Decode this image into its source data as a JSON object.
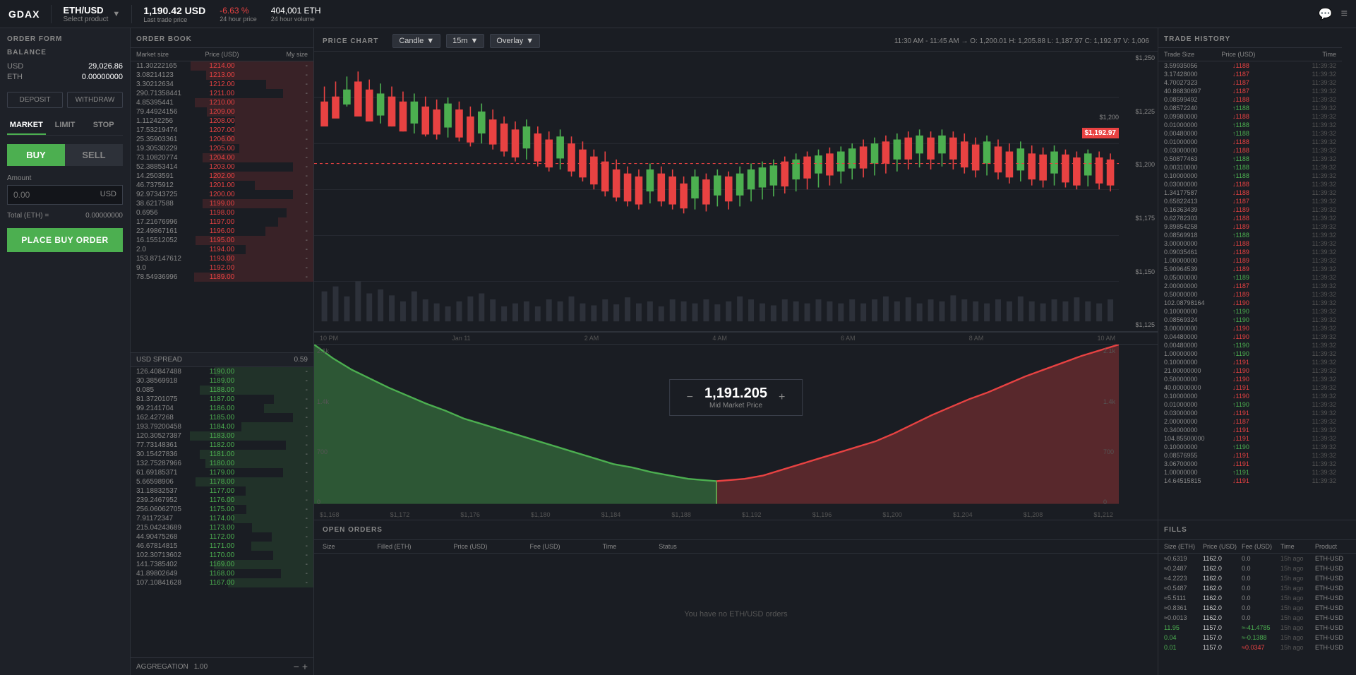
{
  "nav": {
    "logo": "GDAX",
    "pair": "ETH/USD",
    "pair_sub": "Select product",
    "last_price": "1,190.42 USD",
    "last_label": "Last trade price",
    "change": "-6.63 %",
    "change_label": "24 hour price",
    "volume": "404,001 ETH",
    "volume_label": "24 hour volume",
    "chat_icon": "💬",
    "menu_icon": "≡"
  },
  "order_form": {
    "title": "ORDER FORM",
    "balance_title": "BALANCE",
    "usd_label": "USD",
    "usd_amount": "29,026.86",
    "eth_label": "ETH",
    "eth_amount": "0.00000000",
    "deposit_label": "DEPOSIT",
    "withdraw_label": "WITHDRAW",
    "tab_market": "MARKET",
    "tab_limit": "LIMIT",
    "tab_stop": "STOP",
    "buy_label": "BUY",
    "sell_label": "SELL",
    "amount_label": "Amount",
    "amount_placeholder": "0.00",
    "amount_suffix": "USD",
    "total_label": "Total (ETH) =",
    "total_value": "0.00000000",
    "place_order_btn": "PLACE BUY ORDER"
  },
  "order_book": {
    "title": "ORDER BOOK",
    "col_market_size": "Market size",
    "col_price": "Price (USD)",
    "col_my_size": "My size",
    "asks": [
      {
        "size": "11.30222165",
        "price": "1214.00"
      },
      {
        "size": "3.08214123",
        "price": "1213.00"
      },
      {
        "size": "3.30212634",
        "price": "1212.00"
      },
      {
        "size": "290.71358441",
        "price": "1211.00"
      },
      {
        "size": "4.85395441",
        "price": "1210.00"
      },
      {
        "size": "79.44924156",
        "price": "1209.00"
      },
      {
        "size": "1.11242256",
        "price": "1208.00"
      },
      {
        "size": "17.53219474",
        "price": "1207.00"
      },
      {
        "size": "25.35903361",
        "price": "1206.00"
      },
      {
        "size": "19.30530229",
        "price": "1205.00"
      },
      {
        "size": "73.10820774",
        "price": "1204.00"
      },
      {
        "size": "52.38853414",
        "price": "1203.00"
      },
      {
        "size": "14.2503591",
        "price": "1202.00"
      },
      {
        "size": "46.7375912",
        "price": "1201.00"
      },
      {
        "size": "92.97343725",
        "price": "1200.00"
      },
      {
        "size": "38.6217588",
        "price": "1199.00"
      },
      {
        "size": "0.6956",
        "price": "1198.00"
      },
      {
        "size": "17.21676996",
        "price": "1197.00"
      },
      {
        "size": "22.49867161",
        "price": "1196.00"
      },
      {
        "size": "16.15512052",
        "price": "1195.00"
      },
      {
        "size": "2.0",
        "price": "1194.00"
      },
      {
        "size": "153.87147612",
        "price": "1193.00"
      },
      {
        "size": "9.0",
        "price": "1192.00"
      },
      {
        "size": "78.54936996",
        "price": "1189.00"
      }
    ],
    "spread_label": "USD SPREAD",
    "spread_value": "0.59",
    "bids": [
      {
        "size": "126.40847488",
        "price": "1190.00"
      },
      {
        "size": "30.38569918",
        "price": "1189.00"
      },
      {
        "size": "0.085",
        "price": "1188.00"
      },
      {
        "size": "81.37201075",
        "price": "1187.00"
      },
      {
        "size": "99.2141704",
        "price": "1186.00"
      },
      {
        "size": "162.427268",
        "price": "1185.00"
      },
      {
        "size": "193.79200458",
        "price": "1184.00"
      },
      {
        "size": "120.30527387",
        "price": "1183.00"
      },
      {
        "size": "77.73148361",
        "price": "1182.00"
      },
      {
        "size": "30.15427836",
        "price": "1181.00"
      },
      {
        "size": "132.75287966",
        "price": "1180.00"
      },
      {
        "size": "61.69185371",
        "price": "1179.00"
      },
      {
        "size": "5.66598906",
        "price": "1178.00"
      },
      {
        "size": "31.18832537",
        "price": "1177.00"
      },
      {
        "size": "239.2467952",
        "price": "1176.00"
      },
      {
        "size": "256.06062705",
        "price": "1175.00"
      },
      {
        "size": "7.91172347",
        "price": "1174.00"
      },
      {
        "size": "215.04243689",
        "price": "1173.00"
      },
      {
        "size": "44.90475268",
        "price": "1172.00"
      },
      {
        "size": "46.67814815",
        "price": "1171.00"
      },
      {
        "size": "102.30713602",
        "price": "1170.00"
      },
      {
        "size": "141.7385402",
        "price": "1169.00"
      },
      {
        "size": "41.89802649",
        "price": "1168.00"
      },
      {
        "size": "107.10841628",
        "price": "1167.00"
      }
    ],
    "aggregation_label": "AGGREGATION",
    "aggregation_value": "1.00"
  },
  "price_chart": {
    "title": "PRICE CHART",
    "chart_type": "Candle",
    "timeframe": "15m",
    "overlay": "Overlay",
    "stats": "11:30 AM - 11:45 AM → O: 1,200.01  H: 1,205.88  L: 1,187.97  C: 1,192.97  V: 1,006",
    "price_levels": [
      "$1,250",
      "$1,225",
      "$1,200",
      "$1,175",
      "$1,150",
      "$1,125"
    ],
    "time_labels": [
      "10 PM",
      "Jan 11",
      "2 AM",
      "4 AM",
      "6 AM",
      "8 AM",
      "10 AM"
    ],
    "current_price_label": "$1,192.97",
    "ref_price_label": "$1,200",
    "market_price": "1,191.205",
    "market_price_label": "Mid Market Price",
    "depth_y_left": [
      "2.1k",
      "1.4k",
      "700",
      "0"
    ],
    "depth_y_right": [
      "2.1k",
      "1.4k",
      "700",
      "0"
    ],
    "depth_x_labels": [
      "$1,168",
      "$1,172",
      "$1,176",
      "$1,180",
      "$1,184",
      "$1,188",
      "$1,192",
      "$1,196",
      "$1,200",
      "$1,204",
      "$1,208",
      "$1,212"
    ]
  },
  "open_orders": {
    "title": "OPEN ORDERS",
    "col_size": "Size",
    "col_filled": "Filled (ETH)",
    "col_price": "Price (USD)",
    "col_fee": "Fee (USD)",
    "col_time": "Time",
    "col_status": "Status",
    "empty_message": "You have no ETH/USD orders"
  },
  "fills": {
    "title": "FILLS",
    "col_size": "Size (ETH)",
    "col_price": "Price (USD)",
    "col_fee": "Fee (USD)",
    "col_time": "Time",
    "col_product": "Product",
    "rows": [
      {
        "size": "≈0.6319",
        "price": "1162.0",
        "fee": "0.0",
        "time": "15h ago",
        "product": "ETH-USD",
        "side": "sell"
      },
      {
        "size": "≈0.2487",
        "price": "1162.0",
        "fee": "0.0",
        "time": "15h ago",
        "product": "ETH-USD",
        "side": "sell"
      },
      {
        "size": "≈4.2223",
        "price": "1162.0",
        "fee": "0.0",
        "time": "15h ago",
        "product": "ETH-USD",
        "side": "sell"
      },
      {
        "size": "≈0.5487",
        "price": "1162.0",
        "fee": "0.0",
        "time": "15h ago",
        "product": "ETH-USD",
        "side": "sell"
      },
      {
        "size": "≈5.5111",
        "price": "1162.0",
        "fee": "0.0",
        "time": "15h ago",
        "product": "ETH-USD",
        "side": "sell"
      },
      {
        "size": "≈0.8361",
        "price": "1162.0",
        "fee": "0.0",
        "time": "15h ago",
        "product": "ETH-USD",
        "side": "sell"
      },
      {
        "size": "≈0.0013",
        "price": "1162.0",
        "fee": "0.0",
        "time": "15h ago",
        "product": "ETH-USD",
        "side": "sell"
      },
      {
        "size": "11.95",
        "price": "1157.0",
        "fee": "≈-41.4785",
        "time": "15h ago",
        "product": "ETH-USD",
        "side": "buy"
      },
      {
        "size": "0.04",
        "price": "1157.0",
        "fee": "≈-0.1388",
        "time": "15h ago",
        "product": "ETH-USD",
        "side": "buy"
      },
      {
        "size": "0.01",
        "price": "1157.0",
        "fee": "≈0.0347",
        "time": "15h ago",
        "product": "ETH-USD",
        "side": "buy"
      }
    ]
  },
  "trade_history": {
    "title": "TRADE HISTORY",
    "col_trade_size": "Trade Size",
    "col_price": "Price (USD)",
    "col_time": "Time",
    "rows": [
      {
        "size": "3.59935056",
        "price": "1188",
        "dir": "down",
        "time": "11:39:32"
      },
      {
        "size": "3.17428000",
        "price": "1187",
        "dir": "down",
        "time": "11:39:32"
      },
      {
        "size": "4.70027323",
        "price": "1187",
        "dir": "down",
        "time": "11:39:32"
      },
      {
        "size": "40.86830697",
        "price": "1187",
        "dir": "down",
        "time": "11:39:32"
      },
      {
        "size": "0.08599492",
        "price": "1188",
        "dir": "down",
        "time": "11:39:32"
      },
      {
        "size": "0.08572240",
        "price": "1188",
        "dir": "up",
        "time": "11:39:32"
      },
      {
        "size": "0.09980000",
        "price": "1188",
        "dir": "down",
        "time": "11:39:32"
      },
      {
        "size": "0.01000000",
        "price": "1188",
        "dir": "up",
        "time": "11:39:32"
      },
      {
        "size": "0.00480000",
        "price": "1188",
        "dir": "up",
        "time": "11:39:32"
      },
      {
        "size": "0.01000000",
        "price": "1188",
        "dir": "down",
        "time": "11:39:32"
      },
      {
        "size": "0.03000000",
        "price": "1188",
        "dir": "down",
        "time": "11:39:32"
      },
      {
        "size": "0.50877463",
        "price": "1188",
        "dir": "up",
        "time": "11:39:32"
      },
      {
        "size": "0.00310000",
        "price": "1188",
        "dir": "up",
        "time": "11:39:32"
      },
      {
        "size": "0.10000000",
        "price": "1188",
        "dir": "up",
        "time": "11:39:32"
      },
      {
        "size": "0.03000000",
        "price": "1188",
        "dir": "down",
        "time": "11:39:32"
      },
      {
        "size": "1.34177587",
        "price": "1188",
        "dir": "down",
        "time": "11:39:32"
      },
      {
        "size": "0.65822413",
        "price": "1187",
        "dir": "down",
        "time": "11:39:32"
      },
      {
        "size": "0.16363439",
        "price": "1189",
        "dir": "down",
        "time": "11:39:32"
      },
      {
        "size": "0.62782303",
        "price": "1188",
        "dir": "down",
        "time": "11:39:32"
      },
      {
        "size": "9.89854258",
        "price": "1189",
        "dir": "down",
        "time": "11:39:32"
      },
      {
        "size": "0.08569918",
        "price": "1188",
        "dir": "up",
        "time": "11:39:32"
      },
      {
        "size": "3.00000000",
        "price": "1188",
        "dir": "down",
        "time": "11:39:32"
      },
      {
        "size": "0.09035461",
        "price": "1189",
        "dir": "down",
        "time": "11:39:32"
      },
      {
        "size": "1.00000000",
        "price": "1189",
        "dir": "down",
        "time": "11:39:32"
      },
      {
        "size": "5.90964539",
        "price": "1189",
        "dir": "down",
        "time": "11:39:32"
      },
      {
        "size": "0.05000000",
        "price": "1189",
        "dir": "up",
        "time": "11:39:32"
      },
      {
        "size": "2.00000000",
        "price": "1187",
        "dir": "down",
        "time": "11:39:32"
      },
      {
        "size": "0.50000000",
        "price": "1189",
        "dir": "down",
        "time": "11:39:32"
      },
      {
        "size": "102.08798164",
        "price": "1190",
        "dir": "down",
        "time": "11:39:32"
      },
      {
        "size": "0.10000000",
        "price": "1190",
        "dir": "up",
        "time": "11:39:32"
      },
      {
        "size": "0.08569324",
        "price": "1190",
        "dir": "up",
        "time": "11:39:32"
      },
      {
        "size": "3.00000000",
        "price": "1190",
        "dir": "down",
        "time": "11:39:32"
      },
      {
        "size": "0.04480000",
        "price": "1190",
        "dir": "down",
        "time": "11:39:32"
      },
      {
        "size": "0.00480000",
        "price": "1190",
        "dir": "up",
        "time": "11:39:32"
      },
      {
        "size": "1.00000000",
        "price": "1190",
        "dir": "up",
        "time": "11:39:32"
      },
      {
        "size": "0.10000000",
        "price": "1191",
        "dir": "down",
        "time": "11:39:32"
      },
      {
        "size": "21.00000000",
        "price": "1190",
        "dir": "down",
        "time": "11:39:32"
      },
      {
        "size": "0.50000000",
        "price": "1190",
        "dir": "down",
        "time": "11:39:32"
      },
      {
        "size": "40.00000000",
        "price": "1191",
        "dir": "down",
        "time": "11:39:32"
      },
      {
        "size": "0.10000000",
        "price": "1190",
        "dir": "down",
        "time": "11:39:32"
      },
      {
        "size": "0.01000000",
        "price": "1190",
        "dir": "up",
        "time": "11:39:32"
      },
      {
        "size": "0.03000000",
        "price": "1191",
        "dir": "down",
        "time": "11:39:32"
      },
      {
        "size": "2.00000000",
        "price": "1187",
        "dir": "down",
        "time": "11:39:32"
      },
      {
        "size": "0.34000000",
        "price": "1191",
        "dir": "down",
        "time": "11:39:32"
      },
      {
        "size": "104.85500000",
        "price": "1191",
        "dir": "down",
        "time": "11:39:32"
      },
      {
        "size": "0.10000000",
        "price": "1190",
        "dir": "up",
        "time": "11:39:32"
      },
      {
        "size": "0.08576955",
        "price": "1191",
        "dir": "down",
        "time": "11:39:32"
      },
      {
        "size": "3.06700000",
        "price": "1191",
        "dir": "down",
        "time": "11:39:32"
      },
      {
        "size": "1.00000000",
        "price": "1191",
        "dir": "up",
        "time": "11:39:32"
      },
      {
        "size": "14.64515815",
        "price": "1191",
        "dir": "down",
        "time": "11:39:32"
      }
    ]
  }
}
